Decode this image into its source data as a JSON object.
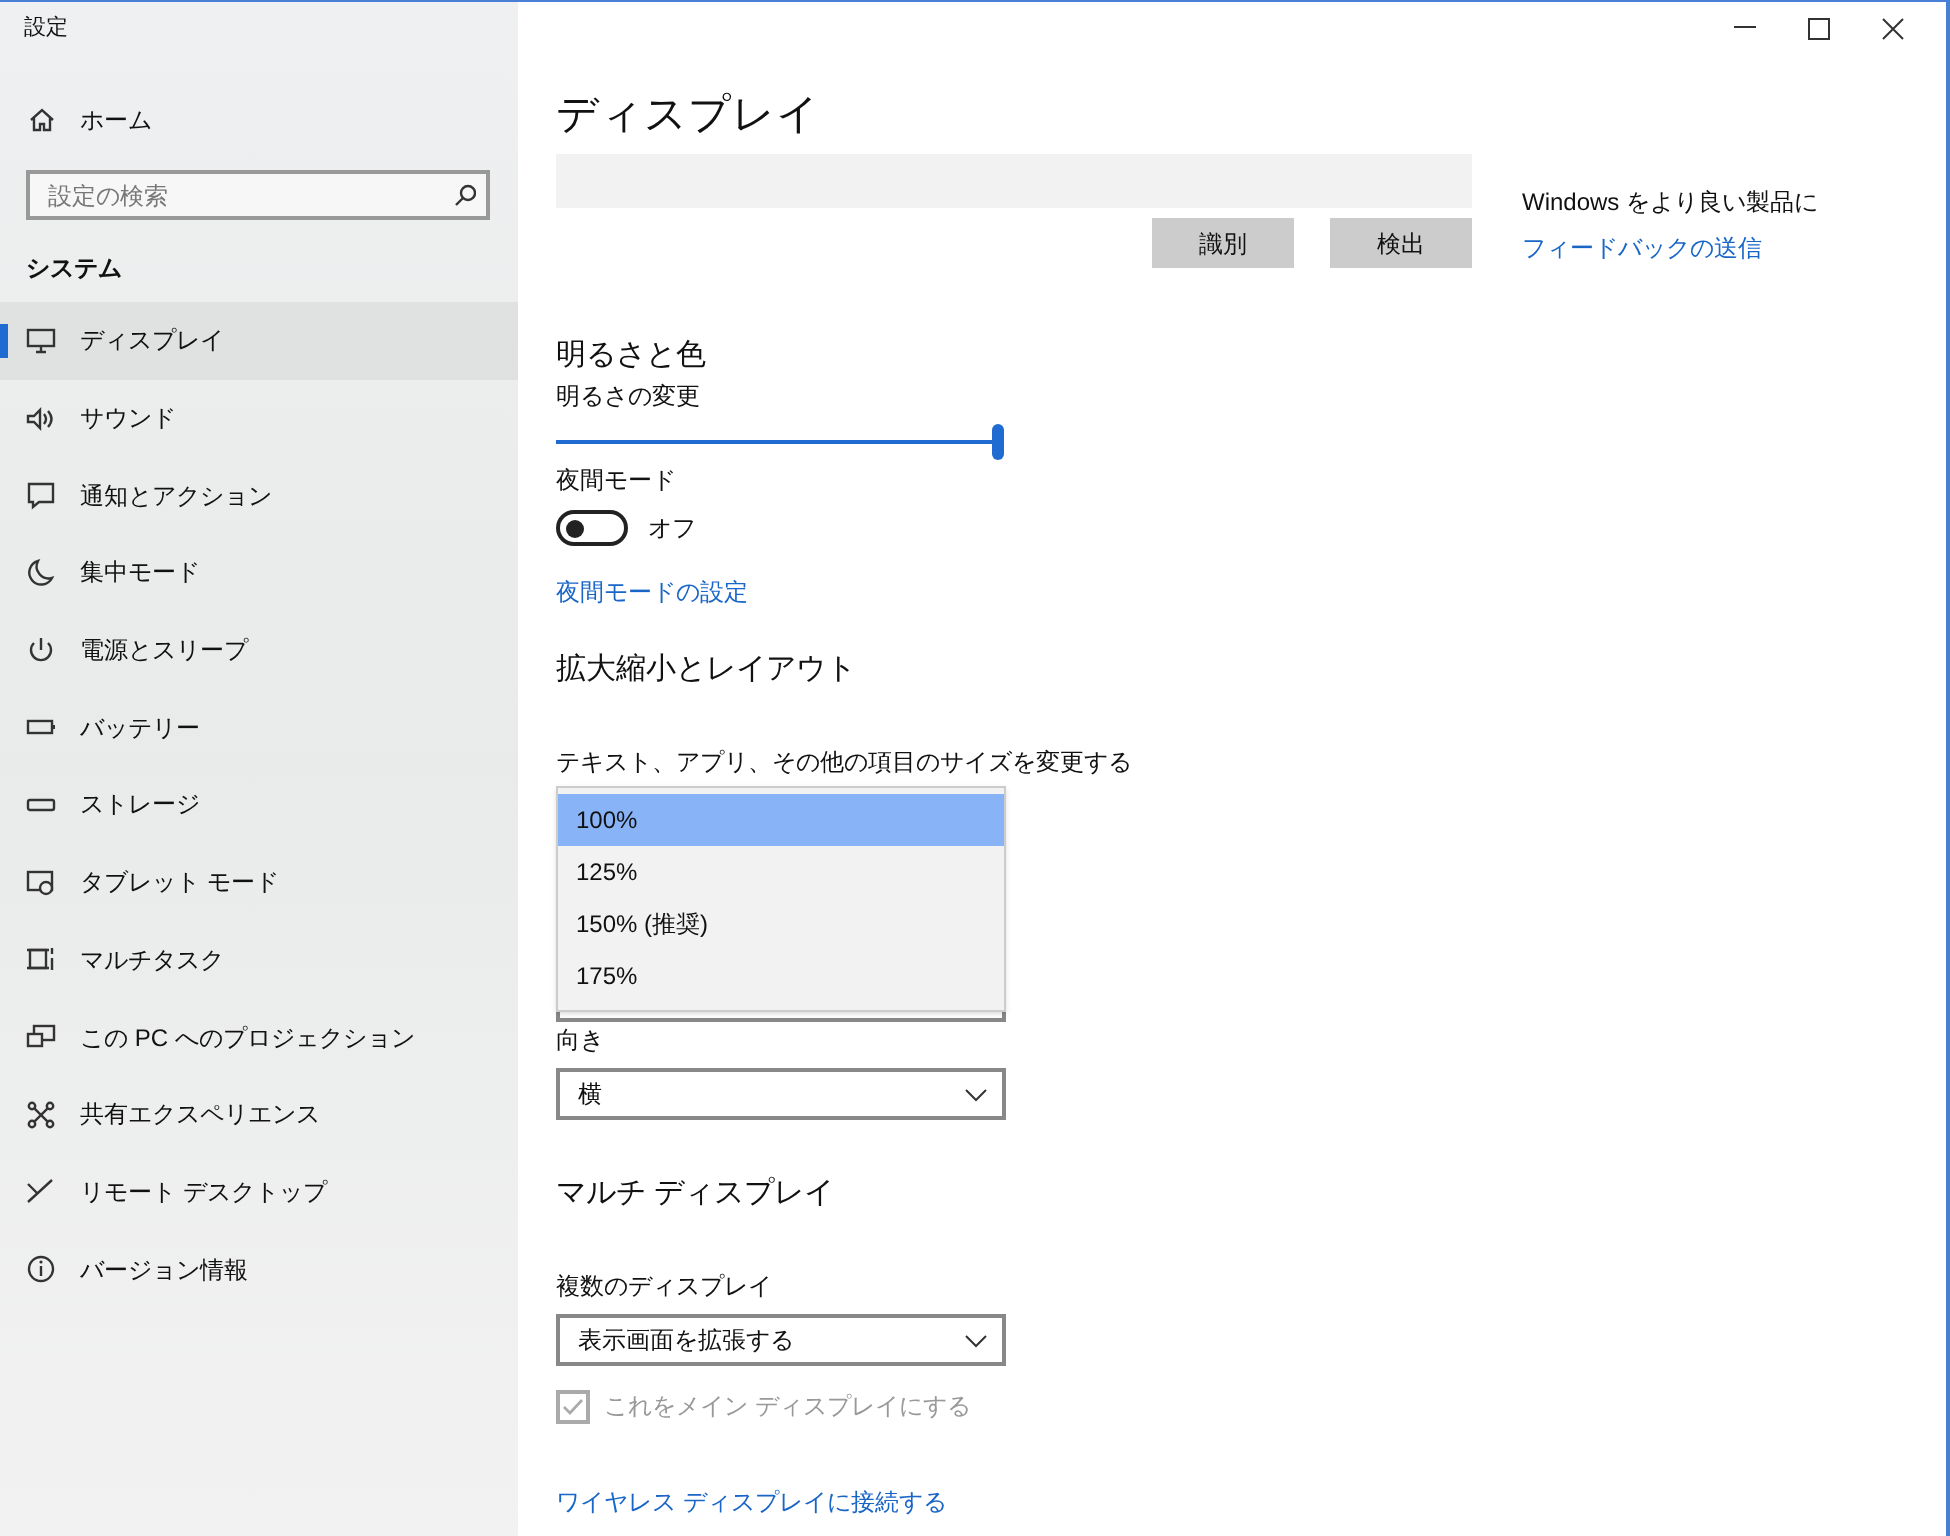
{
  "window": {
    "title": "設定"
  },
  "sidebar": {
    "home": "ホーム",
    "search": {
      "placeholder": "設定の検索"
    },
    "section": "システム",
    "items": [
      {
        "label": "ディスプレイ",
        "selected": true
      },
      {
        "label": "サウンド",
        "selected": false
      },
      {
        "label": "通知とアクション",
        "selected": false
      },
      {
        "label": "集中モード",
        "selected": false
      },
      {
        "label": "電源とスリープ",
        "selected": false
      },
      {
        "label": "バッテリー",
        "selected": false
      },
      {
        "label": "ストレージ",
        "selected": false
      },
      {
        "label": "タブレット モード",
        "selected": false
      },
      {
        "label": "マルチタスク",
        "selected": false
      },
      {
        "label": "この PC へのプロジェクション",
        "selected": false
      },
      {
        "label": "共有エクスペリエンス",
        "selected": false
      },
      {
        "label": "リモート デスクトップ",
        "selected": false
      },
      {
        "label": "バージョン情報",
        "selected": false
      }
    ]
  },
  "page": {
    "title": "ディスプレイ",
    "buttons": [
      "識別",
      "検出"
    ],
    "aside": {
      "text": "Windows をより良い製品に",
      "link": "フィードバックの送信"
    },
    "brightness": {
      "heading": "明るさと色",
      "label": "明るさの変更",
      "level": 1
    },
    "night_mode": {
      "label": "夜間モード",
      "on": false,
      "state": "オフ",
      "link": "夜間モードの設定"
    },
    "scale": {
      "heading": "拡大縮小とレイアウト",
      "label": "テキスト、アプリ、その他の項目のサイズを変更する",
      "options": [
        {
          "label": "100%",
          "selected": true
        },
        {
          "label": "125%",
          "selected": false
        },
        {
          "label": "150% (推奨)",
          "selected": false
        },
        {
          "label": "175%",
          "selected": false
        }
      ]
    },
    "orientation": {
      "label": "向き",
      "value": "横"
    },
    "multi": {
      "heading": "マルチ ディスプレイ",
      "label": "複数のディスプレイ",
      "value": "表示画面を拡張する",
      "main_checkbox": {
        "label": "これをメイン ディスプレイにする",
        "checked": true,
        "disabled": true
      },
      "link": "ワイヤレス ディスプレイに接続する"
    }
  }
}
